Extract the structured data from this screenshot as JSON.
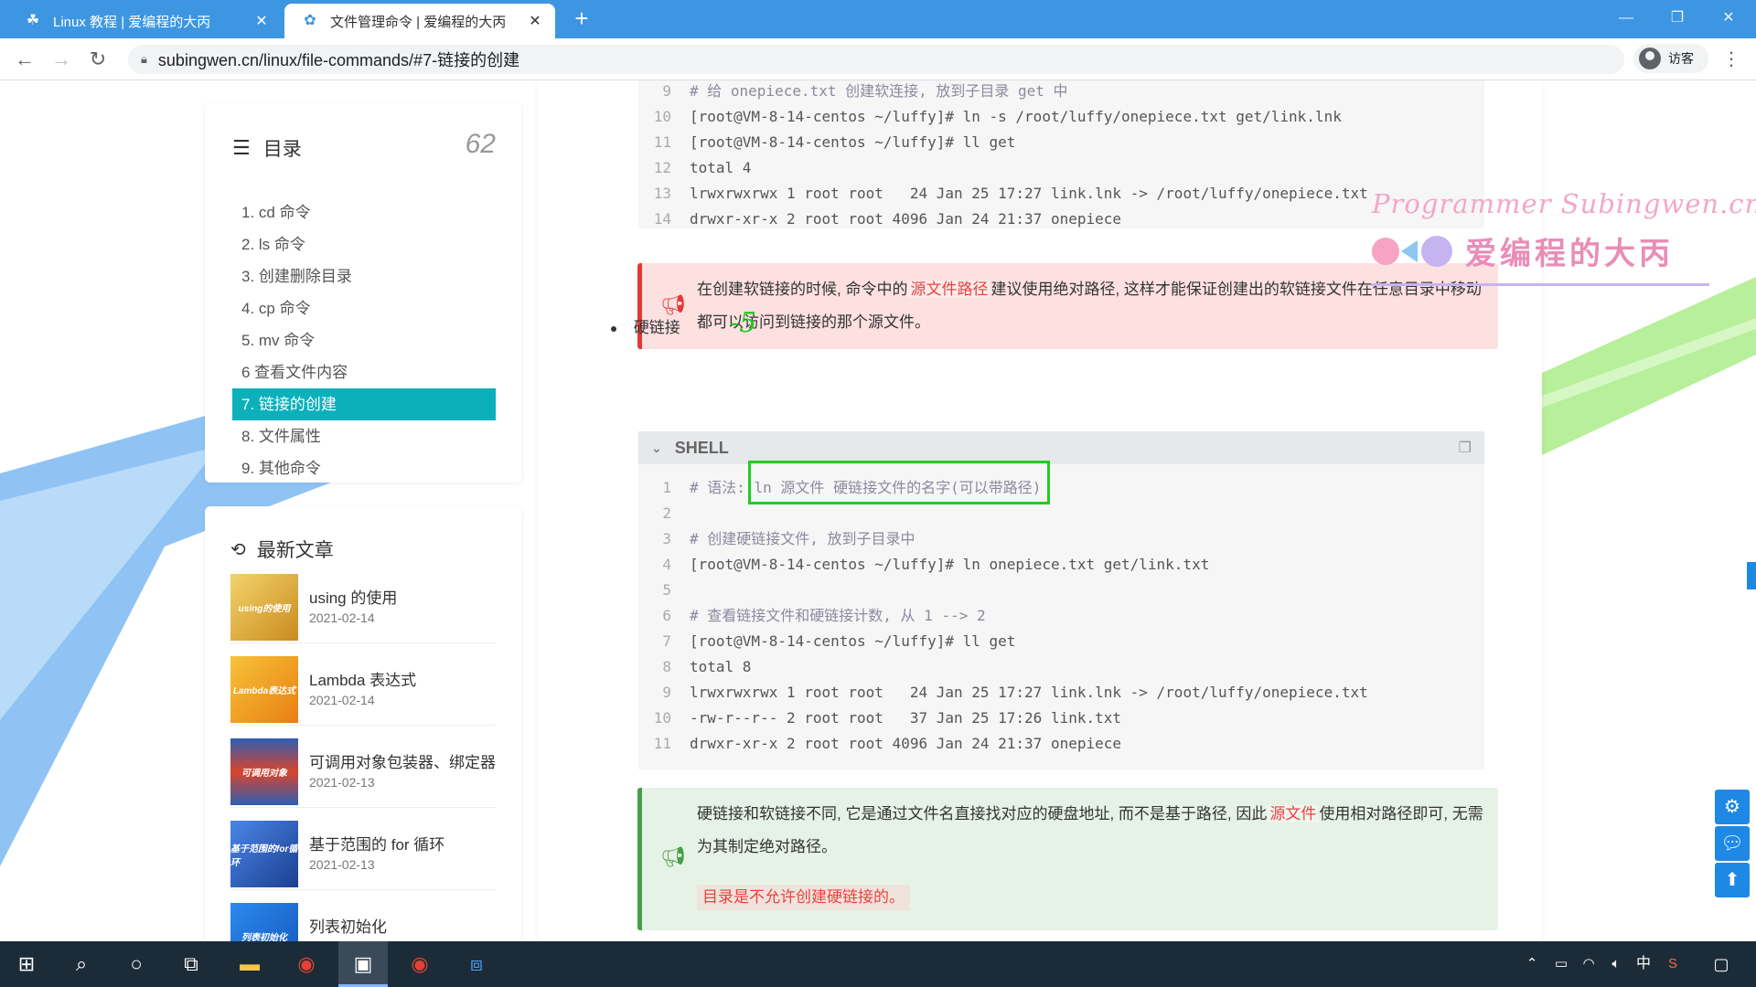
{
  "browser": {
    "tabs": [
      {
        "title": "Linux 教程 | 爱编程的大丙",
        "close": "✕",
        "active": false
      },
      {
        "title": "文件管理命令 | 爱编程的大丙",
        "close": "✕",
        "active": true
      }
    ],
    "new_tab": "+",
    "url": "subingwen.cn/linux/file-commands/#7-链接的创建",
    "profile_label": "访客"
  },
  "toc": {
    "title": "目录",
    "count": "62",
    "items": [
      {
        "label": "1. cd 命令"
      },
      {
        "label": "2. ls 命令"
      },
      {
        "label": "3. 创建删除目录"
      },
      {
        "label": "4. cp 命令"
      },
      {
        "label": "5. mv 命令"
      },
      {
        "label": "6 查看文件内容"
      },
      {
        "label": "7. 链接的创建",
        "active": true
      },
      {
        "label": "8. 文件属性"
      },
      {
        "label": "9. 其他命令"
      }
    ]
  },
  "recent": {
    "title": "最新文章",
    "posts": [
      {
        "title": "using 的使用",
        "date": "2021-02-14",
        "thumb_text": "using的使用",
        "thumb_color": "#e8b94a"
      },
      {
        "title": "Lambda 表达式",
        "date": "2021-02-14",
        "thumb_text": "Lambda表达式",
        "thumb_color": "#f2a323"
      },
      {
        "title": "可调用对象包装器、绑定器",
        "date": "2021-02-13",
        "thumb_text": "可调用对象",
        "thumb_color": "#2f5fb3"
      },
      {
        "title": "基于范围的 for 循环",
        "date": "2021-02-13",
        "thumb_text": "基于范围的for循环",
        "thumb_color": "#2d65c0"
      },
      {
        "title": "列表初始化",
        "date": "",
        "thumb_text": "列表初始化",
        "thumb_color": "#1f6fd6"
      }
    ]
  },
  "code1": {
    "lines": [
      {
        "n": "9",
        "text": "# 给 onepiece.txt 创建软连接, 放到子目录 get 中",
        "comment": true
      },
      {
        "n": "10",
        "text": "[root@VM-8-14-centos ~/luffy]# ln -s /root/luffy/onepiece.txt get/link.lnk"
      },
      {
        "n": "11",
        "text": "[root@VM-8-14-centos ~/luffy]# ll get"
      },
      {
        "n": "12",
        "text": "total 4"
      },
      {
        "n": "13",
        "text": "lrwxrwxrwx 1 root root   24 Jan 25 17:27 link.lnk -> /root/luffy/onepiece.txt"
      },
      {
        "n": "14",
        "text": "drwxr-xr-x 2 root root 4096 Jan 24 21:37 onepiece"
      }
    ]
  },
  "watermark": {
    "line1": "Programmer Subingwen.cn",
    "line2": "爱编程的大丙"
  },
  "note1": {
    "before": "在创建软链接的时候, 命令中的",
    "highlight": "源文件路径",
    "after": "建议使用绝对路径, 这样才能保证创建出的软链接文件在任意目录中移动都可以访问到链接的那个源文件。",
    "color": "#e53935"
  },
  "bullet": {
    "label": "硬链接",
    "annotation": "-5"
  },
  "shell_label": "SHELL",
  "code2": {
    "lines": [
      {
        "n": "1",
        "text": "# 语法: ln 源文件 硬链接文件的名字(可以带路径)",
        "comment": true
      },
      {
        "n": "2",
        "text": ""
      },
      {
        "n": "3",
        "text": "# 创建硬链接文件, 放到子目录中",
        "comment": true
      },
      {
        "n": "4",
        "text": "[root@VM-8-14-centos ~/luffy]# ln onepiece.txt get/link.txt"
      },
      {
        "n": "5",
        "text": ""
      },
      {
        "n": "6",
        "text": "# 查看链接文件和硬链接计数, 从 1 --> 2",
        "comment": true
      },
      {
        "n": "7",
        "text": "[root@VM-8-14-centos ~/luffy]# ll get"
      },
      {
        "n": "8",
        "text": "total 8"
      },
      {
        "n": "9",
        "text": "lrwxrwxrwx 1 root root   24 Jan 25 17:27 link.lnk -> /root/luffy/onepiece.txt"
      },
      {
        "n": "10",
        "text": "-rw-r--r-- 2 root root   37 Jan 25 17:26 link.txt"
      },
      {
        "n": "11",
        "text": "drwxr-xr-x 2 root root 4096 Jan 24 21:37 onepiece"
      }
    ]
  },
  "note2": {
    "before": "硬链接和软链接不同, 它是通过文件名直接找对应的硬盘地址, 而不是基于路径, 因此",
    "highlight": "源文件",
    "after": "使用相对路径即可, 无需为其制定绝对路径。",
    "warn": "目录是不允许创建硬链接的。",
    "color": "#43a047"
  },
  "taskbar": {
    "ime": "中",
    "accent": "#1c2b38"
  },
  "colors": {
    "tab_bar": "#3d96e2",
    "toc_active": "#0bb0bb",
    "note_red_bg": "#fde0e0",
    "note_green_bg": "#e6f2e6",
    "highlight_box": "#22cc22"
  }
}
